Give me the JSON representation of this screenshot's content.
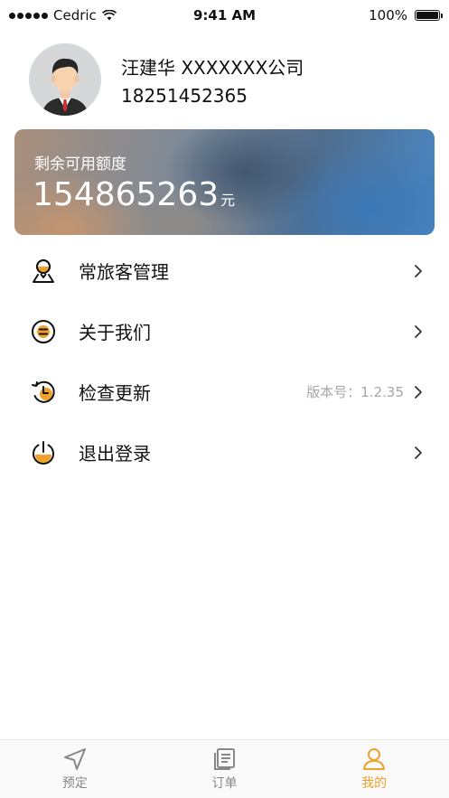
{
  "status_bar": {
    "carrier": "Cedric",
    "time": "9:41 AM",
    "battery_percent": "100%"
  },
  "profile": {
    "name": "汪建华 XXXXXXX公司",
    "phone": "18251452365"
  },
  "credit": {
    "label": "剩余可用额度",
    "amount": "154865263",
    "unit": "元"
  },
  "menu": {
    "items": [
      {
        "label": "常旅客管理",
        "icon": "frequent-traveler-icon"
      },
      {
        "label": "关于我们",
        "icon": "about-icon"
      },
      {
        "label": "检查更新",
        "icon": "update-icon",
        "extra": "版本号：1.2.35"
      },
      {
        "label": "退出登录",
        "icon": "logout-icon"
      }
    ]
  },
  "tab_bar": {
    "tabs": [
      {
        "label": "预定",
        "icon": "navigation-arrow-icon",
        "active": false
      },
      {
        "label": "订单",
        "icon": "order-list-icon",
        "active": false
      },
      {
        "label": "我的",
        "icon": "user-profile-icon",
        "active": true
      }
    ]
  },
  "colors": {
    "accent": "#f0a12a",
    "tab_inactive": "#888888",
    "secondary_text": "#a6a6a6"
  }
}
